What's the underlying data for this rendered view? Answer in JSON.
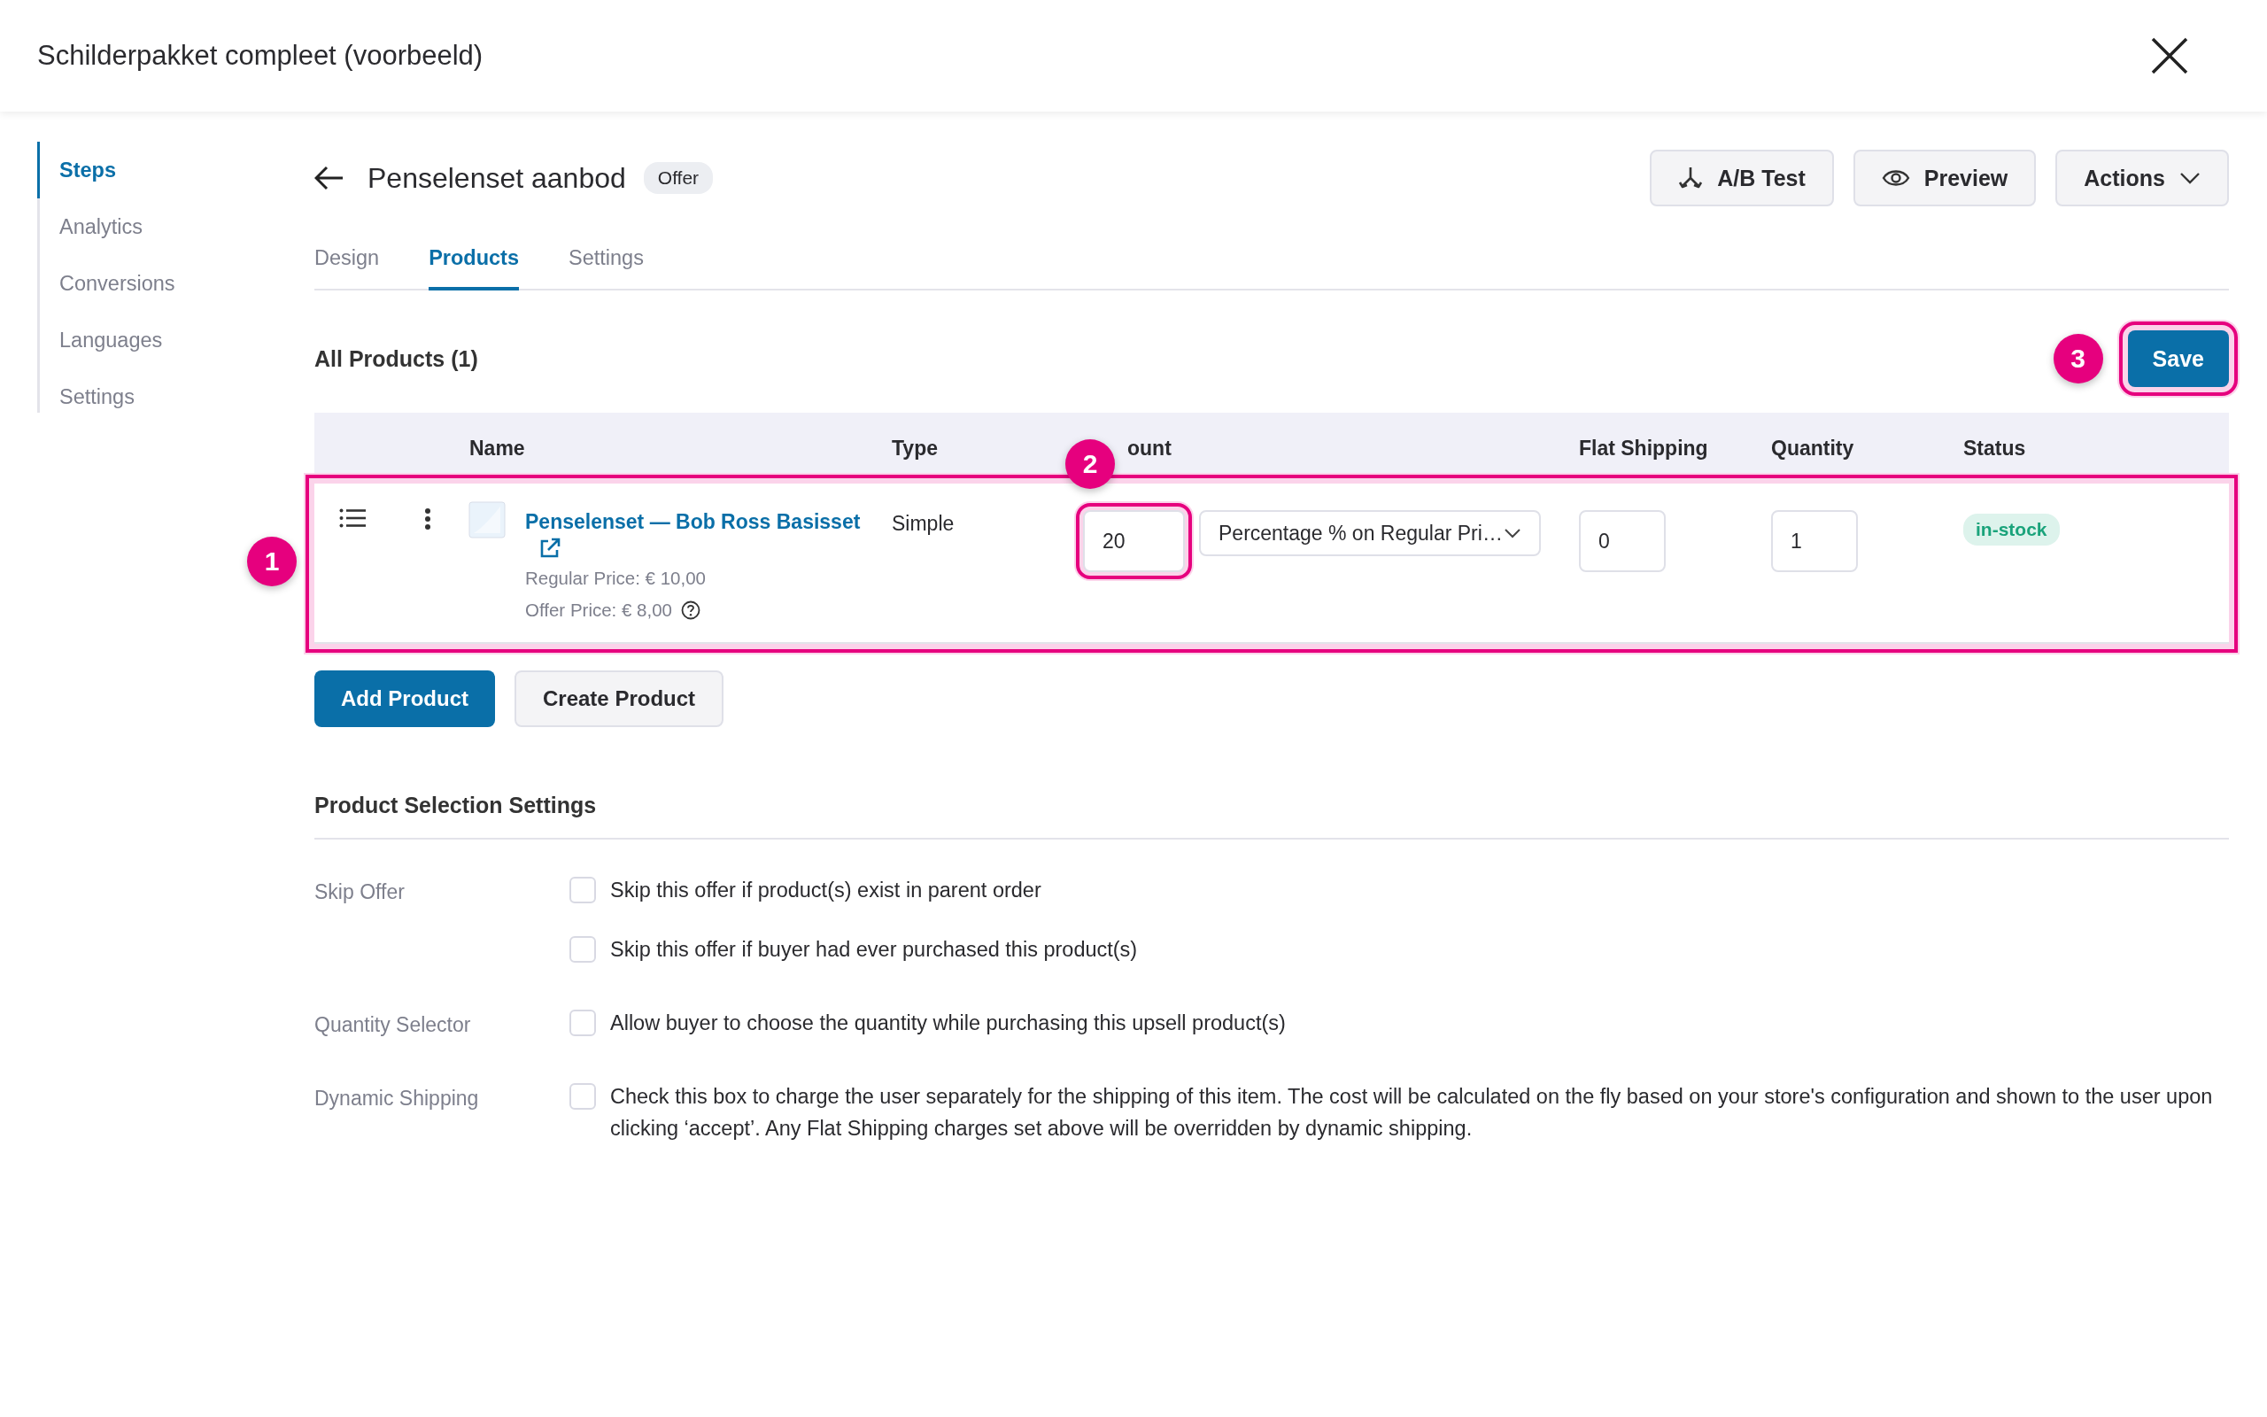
{
  "dialog": {
    "title": "Schilderpakket compleet (voorbeeld)"
  },
  "sidebar": {
    "items": [
      {
        "label": "Steps",
        "selected": true
      },
      {
        "label": "Analytics",
        "selected": false
      },
      {
        "label": "Conversions",
        "selected": false
      },
      {
        "label": "Languages",
        "selected": false
      },
      {
        "label": "Settings",
        "selected": false
      }
    ]
  },
  "step": {
    "title": "Penselenset aanbod",
    "badge": "Offer"
  },
  "actions": [
    {
      "label": "A/B Test",
      "kind": "split"
    },
    {
      "label": "Preview",
      "kind": "eye"
    },
    {
      "label": "Actions",
      "kind": "menu"
    }
  ],
  "tabs": [
    {
      "label": "Design",
      "selected": false
    },
    {
      "label": "Products",
      "selected": true
    },
    {
      "label": "Settings",
      "selected": false
    }
  ],
  "products": {
    "heading": "All Products (1)",
    "save": {
      "label": "Save",
      "callout": "3"
    },
    "columns": [
      "Name",
      "Type",
      "ount",
      "Flat Shipping",
      "Quantity",
      "Status"
    ],
    "rows": [
      {
        "callout": "1",
        "name": "Penselenset — Bob Ross Basisset",
        "regular_price": "Regular Price: € 10,00",
        "offer_price": "Offer Price: € 8,00",
        "type": "Simple",
        "discount_value": "20",
        "discount_callout": "2",
        "discount_type": "Percentage % on Regular Pri…",
        "flat_shipping": "0",
        "quantity": "1",
        "status": "in-stock"
      }
    ],
    "buttons": [
      {
        "label": "Add Product",
        "kind": "primary"
      },
      {
        "label": "Create Product",
        "kind": "secondary"
      }
    ]
  },
  "settings": {
    "heading": "Product Selection Settings",
    "rows": [
      {
        "label": "Skip Offer",
        "options": [
          {
            "text": "Skip this offer if product(s) exist in parent order",
            "checked": false
          },
          {
            "text": "Skip this offer if buyer had ever purchased this product(s)",
            "checked": false
          }
        ]
      },
      {
        "label": "Quantity Selector",
        "options": [
          {
            "text": "Allow buyer to choose the quantity while purchasing this upsell product(s)",
            "checked": false
          }
        ]
      },
      {
        "label": "Dynamic Shipping",
        "options": [
          {
            "text": "Check this box to charge the user separately for the shipping of this item. The cost will be calculated on the fly based on your store's configuration and shown to the user upon clicking ‘accept’. Any Flat Shipping charges set above will be overridden by dynamic shipping.",
            "checked": false
          }
        ]
      }
    ]
  }
}
